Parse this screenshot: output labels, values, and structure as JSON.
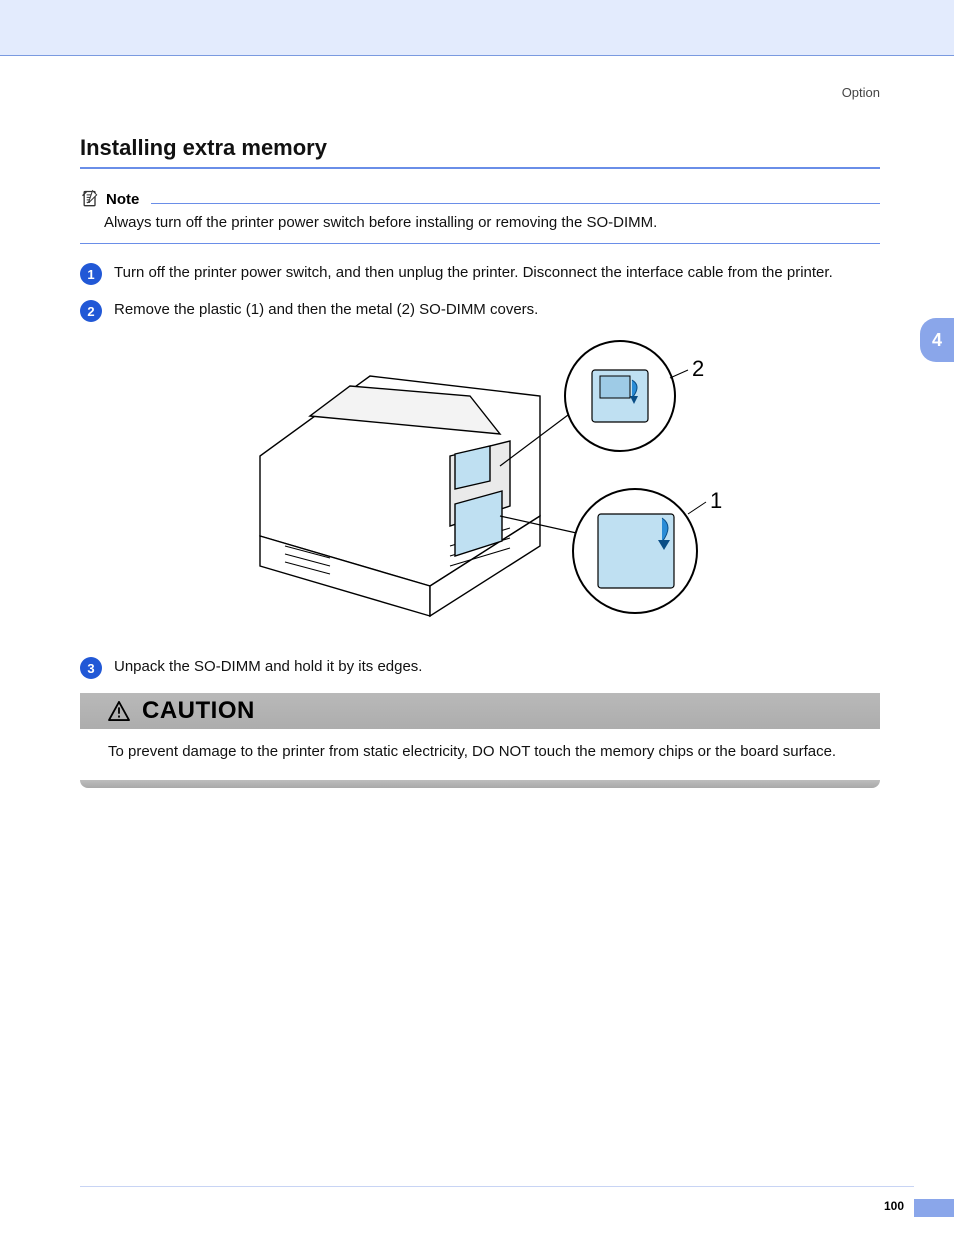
{
  "header": {
    "section": "Option"
  },
  "page": {
    "title": "Installing extra memory",
    "note_label": "Note",
    "note_body": "Always turn off the printer power switch before installing or removing the SO-DIMM.",
    "steps": [
      {
        "n": "1",
        "text": "Turn off the printer power switch, and then unplug the printer. Disconnect the interface cable from the printer."
      },
      {
        "n": "2",
        "text": "Remove the plastic (1) and then the metal (2) SO-DIMM covers."
      },
      {
        "n": "3",
        "text": "Unpack the SO-DIMM and hold it by its edges."
      }
    ],
    "callouts": {
      "a": "2",
      "b": "1"
    },
    "caution_label": "CAUTION",
    "caution_body": "To prevent damage to the printer from static electricity, DO NOT touch the memory chips or the board surface."
  },
  "chrome": {
    "chapter_tab": "4",
    "page_number": "100"
  }
}
